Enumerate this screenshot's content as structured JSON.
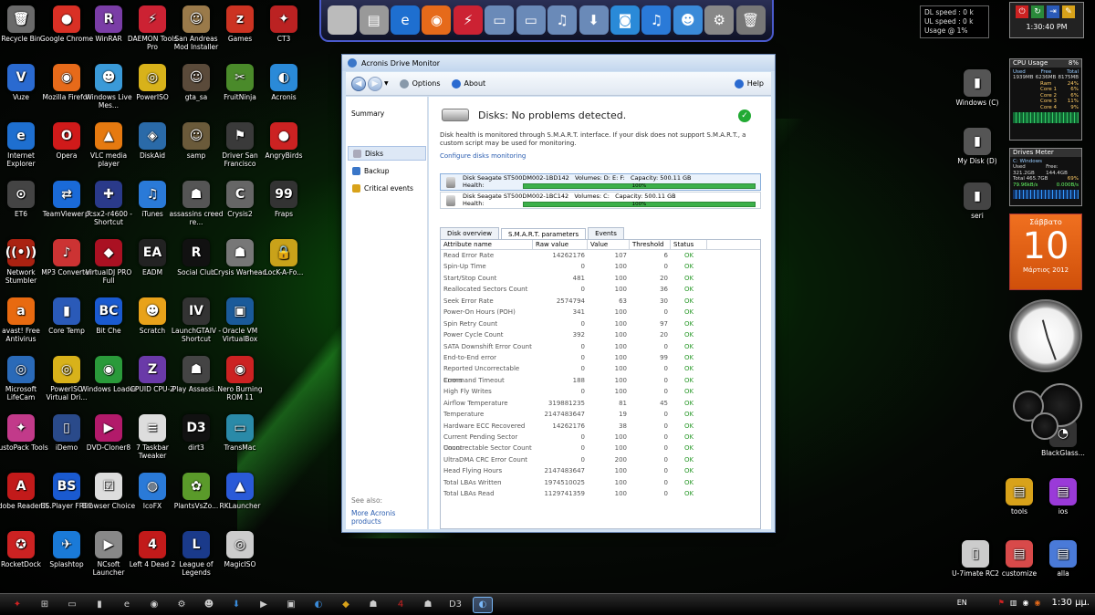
{
  "desktop": {
    "icons": [
      {
        "label": "Recycle Bin",
        "color": "#6a6a6a",
        "glyph": "🗑"
      },
      {
        "label": "Google Chrome",
        "color": "#d93025",
        "glyph": "●"
      },
      {
        "label": "WinRAR",
        "color": "#7a3da6",
        "glyph": "R"
      },
      {
        "label": "DAEMON Tools Pro",
        "color": "#c23",
        "glyph": "⚡"
      },
      {
        "label": "San Andreas Mod Installer",
        "color": "#9a7a4a",
        "glyph": "☺"
      },
      {
        "label": "Games",
        "color": "#c32",
        "glyph": "z"
      },
      {
        "label": "CT3",
        "color": "#b22",
        "glyph": "✦"
      },
      {
        "label": "Vuze",
        "color": "#2a6ad0",
        "glyph": "V"
      },
      {
        "label": "Mozilla Firefox",
        "color": "#e66a1a",
        "glyph": "◉"
      },
      {
        "label": "Windows Live Mes...",
        "color": "#3a9ad8",
        "glyph": "☻"
      },
      {
        "label": "PowerISO",
        "color": "#d8b21a",
        "glyph": "◎"
      },
      {
        "label": "gta_sa",
        "color": "#5a4a3a",
        "glyph": "☺"
      },
      {
        "label": "FruitNinja",
        "color": "#4a8a2a",
        "glyph": "✂"
      },
      {
        "label": "Acronis",
        "color": "#2a8ad8",
        "glyph": "◐"
      },
      {
        "label": "Internet Explorer",
        "color": "#1e6fd0",
        "glyph": "e"
      },
      {
        "label": "Opera",
        "color": "#d01a1a",
        "glyph": "O"
      },
      {
        "label": "VLC media player",
        "color": "#e67a10",
        "glyph": "▲"
      },
      {
        "label": "DiskAid",
        "color": "#2a6aa8",
        "glyph": "◈"
      },
      {
        "label": "samp",
        "color": "#6a5a3a",
        "glyph": "☺"
      },
      {
        "label": "Driver San Francisco",
        "color": "#3a3a3a",
        "glyph": "⚑"
      },
      {
        "label": "AngryBirds",
        "color": "#c22",
        "glyph": "●"
      },
      {
        "label": "ET6",
        "color": "#444",
        "glyph": "⊙"
      },
      {
        "label": "TeamViewer 7",
        "color": "#1a6ad8",
        "glyph": "⇄"
      },
      {
        "label": "pcsx2-r4600 - Shortcut",
        "color": "#2a3a8a",
        "glyph": "✚"
      },
      {
        "label": "iTunes",
        "color": "#2a7ad8",
        "glyph": "♫"
      },
      {
        "label": "assassins creed re...",
        "color": "#555",
        "glyph": "☗"
      },
      {
        "label": "Crysis2",
        "color": "#666",
        "glyph": "C"
      },
      {
        "label": "Fraps",
        "color": "#333",
        "glyph": "99"
      },
      {
        "label": "Network Stumbler",
        "color": "#a21",
        "glyph": "((•))"
      },
      {
        "label": "MP3 Converter",
        "color": "#c33",
        "glyph": "♪"
      },
      {
        "label": "VirtualDJ PRO Full",
        "color": "#a12",
        "glyph": "◆"
      },
      {
        "label": "EADM",
        "color": "#222",
        "glyph": "EA"
      },
      {
        "label": "Social Club",
        "color": "#111",
        "glyph": "R"
      },
      {
        "label": "Crysis Warhead",
        "color": "#777",
        "glyph": "☗"
      },
      {
        "label": "LocK-A-Fo...",
        "color": "#c9a21a",
        "glyph": "🔒"
      },
      {
        "label": "avast! Free Antivirus",
        "color": "#e86a10",
        "glyph": "a"
      },
      {
        "label": "Core Temp",
        "color": "#2a5ab8",
        "glyph": "▮"
      },
      {
        "label": "Bit Che",
        "color": "#1a5ad0",
        "glyph": "BC"
      },
      {
        "label": "Scratch",
        "color": "#e8a21a",
        "glyph": "☻"
      },
      {
        "label": "LaunchGTAIV - Shortcut",
        "color": "#333",
        "glyph": "IV"
      },
      {
        "label": "Oracle VM VirtualBox",
        "color": "#1a5a9a",
        "glyph": "▣"
      },
      {
        "label": "",
        "color": "transparent",
        "glyph": ""
      },
      {
        "label": "Microsoft LifeCam",
        "color": "#2a6ab8",
        "glyph": "◎"
      },
      {
        "label": "PowerISO Virtual Dri...",
        "color": "#d8b21a",
        "glyph": "◎"
      },
      {
        "label": "Windows Loader",
        "color": "#2a9a3a",
        "glyph": "◉"
      },
      {
        "label": "CPUID CPU-Z",
        "color": "#6a3aa8",
        "glyph": "Z"
      },
      {
        "label": "Play Assassi...",
        "color": "#444",
        "glyph": "☗"
      },
      {
        "label": "Nero Burning ROM 11",
        "color": "#c22",
        "glyph": "◉"
      },
      {
        "label": "",
        "color": "transparent",
        "glyph": ""
      },
      {
        "label": "CustoPack Tools",
        "color": "#c23a8a",
        "glyph": "✦"
      },
      {
        "label": "iDemo",
        "color": "#2a4a8a",
        "glyph": "▯"
      },
      {
        "label": "DVD-Cloner8",
        "color": "#b21a6a",
        "glyph": "▶"
      },
      {
        "label": "7 Taskbar Tweaker",
        "color": "#ddd",
        "glyph": "≡"
      },
      {
        "label": "dirt3",
        "color": "#111",
        "glyph": "D3"
      },
      {
        "label": "TransMac",
        "color": "#2a8aa8",
        "glyph": "▭"
      },
      {
        "label": "",
        "color": "transparent",
        "glyph": ""
      },
      {
        "label": "Adobe Reader X",
        "color": "#c21a1a",
        "glyph": "A"
      },
      {
        "label": "BS.Player FREE",
        "color": "#1a5ad0",
        "glyph": "BS"
      },
      {
        "label": "Browser Choice",
        "color": "#ddd",
        "glyph": "☑"
      },
      {
        "label": "IcoFX",
        "color": "#2a7ad8",
        "glyph": "◍"
      },
      {
        "label": "PlantsVsZo...",
        "color": "#5a9a2a",
        "glyph": "✿"
      },
      {
        "label": "RKLauncher",
        "color": "#2a5ad8",
        "glyph": "▲"
      },
      {
        "label": "",
        "color": "transparent",
        "glyph": ""
      },
      {
        "label": "RocketDock",
        "color": "#c22",
        "glyph": "✪"
      },
      {
        "label": "Splashtop",
        "color": "#1a7ad8",
        "glyph": "✈"
      },
      {
        "label": "NCsoft Launcher",
        "color": "#888",
        "glyph": "▶"
      },
      {
        "label": "Left 4 Dead 2",
        "color": "#c21a1a",
        "glyph": "4"
      },
      {
        "label": "League of Legends",
        "color": "#1a3a8a",
        "glyph": "L"
      },
      {
        "label": "MagicISO",
        "color": "#ccc",
        "glyph": "◎"
      }
    ],
    "right_icons": [
      {
        "label": "Windows (C)",
        "color": "#555",
        "glyph": "▮"
      },
      {
        "label": "My Disk (D)",
        "color": "#555",
        "glyph": "▮"
      },
      {
        "label": "seri",
        "color": "#444",
        "glyph": "▮"
      },
      {
        "label": "BlackGlass...",
        "color": "#333",
        "glyph": "◔"
      },
      {
        "label": "tools",
        "color": "#d8a21a",
        "glyph": "▤"
      },
      {
        "label": "ios",
        "color": "#9a3ad8",
        "glyph": "▤"
      },
      {
        "label": "U-7imate RC2",
        "color": "#ccc",
        "glyph": "▯"
      },
      {
        "label": "customize",
        "color": "#d84a4a",
        "glyph": "▤"
      },
      {
        "label": "alla",
        "color": "#4a7ad8",
        "glyph": "▤"
      }
    ]
  },
  "dock": {
    "items": [
      {
        "name": "apple",
        "glyph": "",
        "color": "#bbb"
      },
      {
        "name": "drive",
        "glyph": "▤",
        "color": "#999"
      },
      {
        "name": "ie",
        "glyph": "e",
        "color": "#1e6fd0"
      },
      {
        "name": "firefox",
        "glyph": "◉",
        "color": "#e66a1a"
      },
      {
        "name": "daemon",
        "glyph": "⚡",
        "color": "#c23"
      },
      {
        "name": "folder-1",
        "glyph": "▭",
        "color": "#6a8ab8"
      },
      {
        "name": "folder-2",
        "glyph": "▭",
        "color": "#6a8ab8"
      },
      {
        "name": "folder-3",
        "glyph": "♫",
        "color": "#6a8ab8"
      },
      {
        "name": "folder-4",
        "glyph": "⬇",
        "color": "#6a8ab8"
      },
      {
        "name": "facetime",
        "glyph": "◙",
        "color": "#2a8ad8"
      },
      {
        "name": "itunes",
        "glyph": "♫",
        "color": "#2a7ad8"
      },
      {
        "name": "finder",
        "glyph": "☻",
        "color": "#3a8ad8"
      },
      {
        "name": "settings",
        "glyph": "⚙",
        "color": "#888"
      },
      {
        "name": "trash",
        "glyph": "🗑",
        "color": "#777"
      }
    ]
  },
  "widgets": {
    "net": {
      "dl": "DL speed : 0 k",
      "ul": "UL speed : 0 k",
      "usage": "Usage @ 1%"
    },
    "clock": {
      "time": "1:30:40 PM"
    },
    "cpu": {
      "title": "CPU Usage",
      "value": "8%",
      "used_label": "Used",
      "used": "1939MB",
      "free_label": "Free",
      "free": "6236MB",
      "total_label": "Total",
      "total": "8175MB",
      "ram_label": "Ram",
      "ram": "24%",
      "cores": [
        {
          "label": "Core 1",
          "value": "6%"
        },
        {
          "label": "Core 2",
          "value": "6%"
        },
        {
          "label": "Core 3",
          "value": "11%"
        },
        {
          "label": "Core 4",
          "value": "9%"
        }
      ]
    },
    "drives": {
      "title": "Drives Meter",
      "drive": "C: Windows",
      "used_label": "Used",
      "used": "321.2GB",
      "free_label": "Free",
      "free": "144.4GB",
      "total_label": "Total",
      "total": "465.7GB",
      "pct": "69%",
      "speed1": "79.96kB/s",
      "speed2": "0.000B/s"
    },
    "calendar": {
      "weekday": "Σάββατο",
      "day": "10",
      "month_year": "Μάρτιος 2012"
    }
  },
  "window": {
    "title": "Acronis Drive Monitor",
    "toolbar": {
      "options": "Options",
      "about": "About",
      "help": "Help"
    },
    "sidebar": {
      "summary": "Summary",
      "items": [
        "Disks",
        "Backup",
        "Critical events"
      ],
      "see_also": "See also:",
      "more": "More Acronis products"
    },
    "main": {
      "status": "Disks: No problems detected.",
      "description": "Disk health is monitored through S.M.A.R.T. interface. If your disk does not support S.M.A.R.T., a custom script may be used for monitoring.",
      "config_link": "Configure disks monitoring",
      "disks": [
        {
          "name": "Disk Seagate ST500DM002-1BD142",
          "volumes": "Volumes: D: E: F:",
          "capacity": "Capacity: 500.11 GB",
          "health_label": "Health:",
          "health": "100%"
        },
        {
          "name": "Disk Seagate ST500DM002-1BC142",
          "volumes": "Volumes: C:",
          "capacity": "Capacity: 500.11 GB",
          "health_label": "Health:",
          "health": "100%"
        }
      ],
      "tabs": [
        "Disk overview",
        "S.M.A.R.T. parameters",
        "Events"
      ],
      "columns": [
        "Attribute name",
        "Raw value",
        "Value",
        "Threshold",
        "Status"
      ],
      "rows": [
        [
          "Read Error Rate",
          "14262176",
          "107",
          "6",
          "OK"
        ],
        [
          "Spin-Up Time",
          "0",
          "100",
          "0",
          "OK"
        ],
        [
          "Start/Stop Count",
          "481",
          "100",
          "20",
          "OK"
        ],
        [
          "Reallocated Sectors Count",
          "0",
          "100",
          "36",
          "OK"
        ],
        [
          "Seek Error Rate",
          "2574794",
          "63",
          "30",
          "OK"
        ],
        [
          "Power-On Hours (POH)",
          "341",
          "100",
          "0",
          "OK"
        ],
        [
          "Spin Retry Count",
          "0",
          "100",
          "97",
          "OK"
        ],
        [
          "Power Cycle Count",
          "392",
          "100",
          "20",
          "OK"
        ],
        [
          "SATA Downshift Error Count",
          "0",
          "100",
          "0",
          "OK"
        ],
        [
          "End-to-End error",
          "0",
          "100",
          "99",
          "OK"
        ],
        [
          "Reported Uncorrectable Errors",
          "0",
          "100",
          "0",
          "OK"
        ],
        [
          "Command Timeout",
          "188",
          "100",
          "0",
          "OK"
        ],
        [
          "High Fly Writes",
          "0",
          "100",
          "0",
          "OK"
        ],
        [
          "Airflow Temperature",
          "319881235",
          "81",
          "45",
          "OK"
        ],
        [
          "Temperature",
          "2147483647",
          "19",
          "0",
          "OK"
        ],
        [
          "Hardware ECC Recovered",
          "14262176",
          "38",
          "0",
          "OK"
        ],
        [
          "Current Pending Sector Count",
          "0",
          "100",
          "0",
          "OK"
        ],
        [
          "Uncorrectable Sector Count",
          "0",
          "100",
          "0",
          "OK"
        ],
        [
          "UltraDMA CRC Error Count",
          "0",
          "200",
          "0",
          "OK"
        ],
        [
          "Head Flying Hours",
          "2147483647",
          "100",
          "0",
          "OK"
        ],
        [
          "Total LBAs Written",
          "1974510025",
          "100",
          "0",
          "OK"
        ],
        [
          "Total LBAs Read",
          "1129741359",
          "100",
          "0",
          "OK"
        ]
      ]
    }
  },
  "taskbar": {
    "items": [
      {
        "name": "start-orb",
        "glyph": "✦",
        "color": "#c22"
      },
      {
        "name": "windows",
        "glyph": "⊞",
        "color": "#ccc"
      },
      {
        "name": "folder",
        "glyph": "▭",
        "color": "#ccc"
      },
      {
        "name": "drive",
        "glyph": "▮",
        "color": "#ccc"
      },
      {
        "name": "ie",
        "glyph": "e",
        "color": "#ccc"
      },
      {
        "name": "firefox",
        "glyph": "◉",
        "color": "#ccc"
      },
      {
        "name": "daemon",
        "glyph": "⚙",
        "color": "#ccc"
      },
      {
        "name": "messenger",
        "glyph": "☻",
        "color": "#ccc"
      },
      {
        "name": "download",
        "glyph": "⬇",
        "color": "#3a8ad8"
      },
      {
        "name": "media",
        "glyph": "▶",
        "color": "#ccc"
      },
      {
        "name": "lock",
        "glyph": "▣",
        "color": "#ccc"
      },
      {
        "name": "acronis",
        "glyph": "◐",
        "color": "#3a8ad8"
      },
      {
        "name": "game-1",
        "glyph": "◆",
        "color": "#d8a21a"
      },
      {
        "name": "game-2",
        "glyph": "☗",
        "color": "#ccc"
      },
      {
        "name": "left4dead",
        "glyph": "4",
        "color": "#c22"
      },
      {
        "name": "game-3",
        "glyph": "☗",
        "color": "#ccc"
      },
      {
        "name": "dirt3",
        "glyph": "D3",
        "color": "#ccc"
      },
      {
        "name": "acronis-active",
        "glyph": "◐",
        "color": "#7ab8f8"
      }
    ],
    "lang": "EN",
    "time": "1:30 μμ."
  }
}
